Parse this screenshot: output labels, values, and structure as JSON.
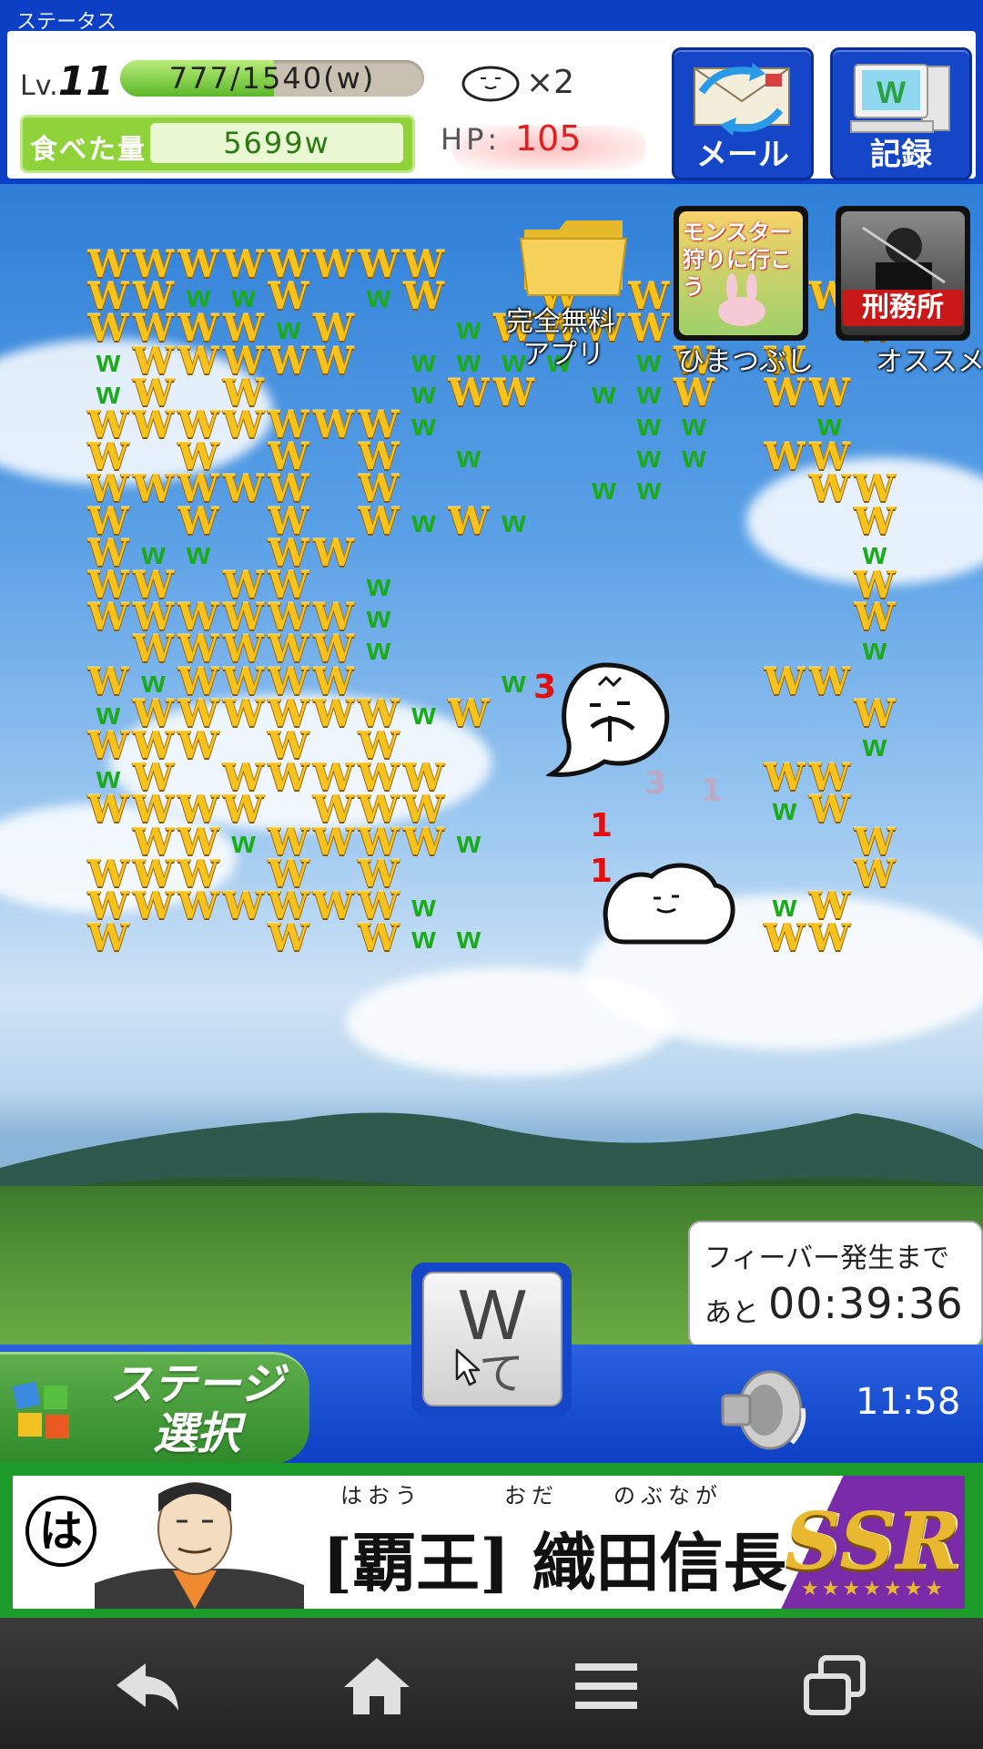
{
  "status": {
    "title": "ステータス",
    "level_prefix": "Lv.",
    "level": "11",
    "xp_text": "777/1540(w)",
    "xp_fraction": 0.505,
    "eaten_label": "食べた量",
    "eaten_value": "5699w",
    "lives_text": "×2",
    "hp_label": "HP:",
    "hp_value": "105"
  },
  "buttons": {
    "mail_label": "メール",
    "record_label": "記録"
  },
  "apps": {
    "free_app_caption": "完全無料\nアプリ",
    "free_app_line1": "完全無料",
    "free_app_line2": "アプリ",
    "app1_title": "モンスター狩りに行こう",
    "app1_caption": "ひまつぶし",
    "app2_title": "刑務所",
    "app2_caption": "オススメ"
  },
  "field": {
    "damage_numbers": [
      "3",
      "1",
      "1"
    ],
    "faint_numbers": [
      "3",
      "1"
    ],
    "grid_rows": [
      "GGGGGGGG...........",
      "GGNNG.NG..G.G..GG..",
      "GGGGNG..NGGGG...G..",
      "NGGGGG.NNNN.NGG....",
      "NG.G...NGG.NNGGG...",
      "GGGGGGGN....NN.N...",
      "G.G.G.G.N...NNGG...",
      "GGGGG.G....NN..GG..",
      "G.G.G.GNGN......G..",
      "GNN.GG..........N..",
      "GG.GG.N.........G..",
      "GGGGGGN.........G..",
      ".GGGGGN.........N..",
      "GNGGGG...N....GG...",
      "NGGGGGGNG.......G..",
      "GGG.G.G.........N..",
      "NG.GGGGG......GG...",
      "GGGG.GGG......NG...",
      ".GGNGGGGN.......G..",
      "GGG.G.G.........G..",
      "GGGGGGGN......NG...",
      "G...G.GNN.....GG..."
    ]
  },
  "fever": {
    "line1": "フィーバー発生まで",
    "line2_prefix": "あと",
    "time": "00:39:36"
  },
  "bottom": {
    "stage_line1": "ステージ",
    "stage_line2": "選択",
    "w_key_letter": "W",
    "w_key_kana": "て",
    "clock": "11:58"
  },
  "ad": {
    "ruby": "はおう　　　おだ　　のぶなが",
    "title": "[覇王] 織田信長",
    "badge": "SSR",
    "stars": "★★★★★★★",
    "circle": "は"
  },
  "colors": {
    "panel_blue": "#0d3fc4",
    "gold_w": "#f6c21e",
    "green_w": "#1aaa1a",
    "damage_red": "#e01010",
    "hp_red": "#e02020"
  }
}
